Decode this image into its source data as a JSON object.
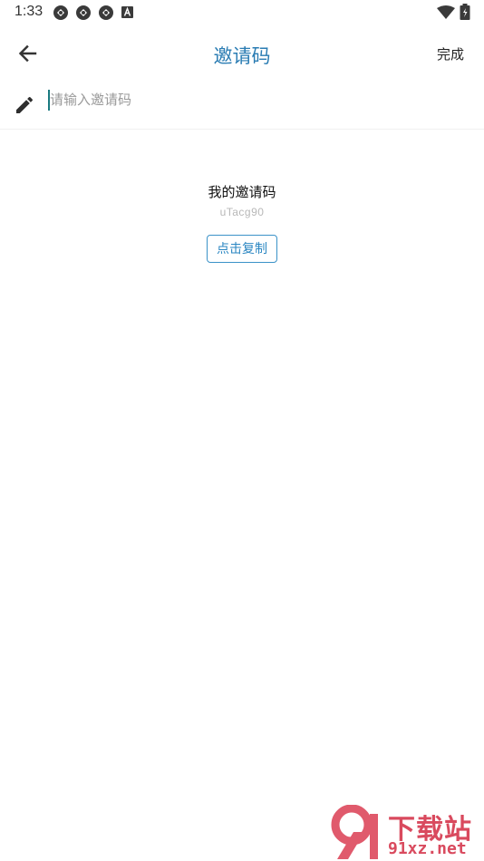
{
  "status_bar": {
    "time": "1:33",
    "icons": [
      "sync-icon",
      "sync-icon",
      "sync-icon",
      "a-badge-icon",
      "wifi-icon",
      "battery-icon"
    ]
  },
  "app_bar": {
    "title": "邀请码",
    "done_label": "完成",
    "back_icon": "arrow-left-icon"
  },
  "input": {
    "icon": "pencil-icon",
    "placeholder": "请输入邀请码",
    "value": ""
  },
  "my_code": {
    "label": "我的邀请码",
    "code": "uTacg90",
    "copy_label": "点击复制"
  },
  "watermark": {
    "top_text": "下载站",
    "bottom_text": "91xz.net"
  },
  "colors": {
    "accent": "#2a7cb3",
    "button_border": "#3b92c8",
    "cursor": "#1a7a80",
    "watermark": "#d94a5e"
  }
}
